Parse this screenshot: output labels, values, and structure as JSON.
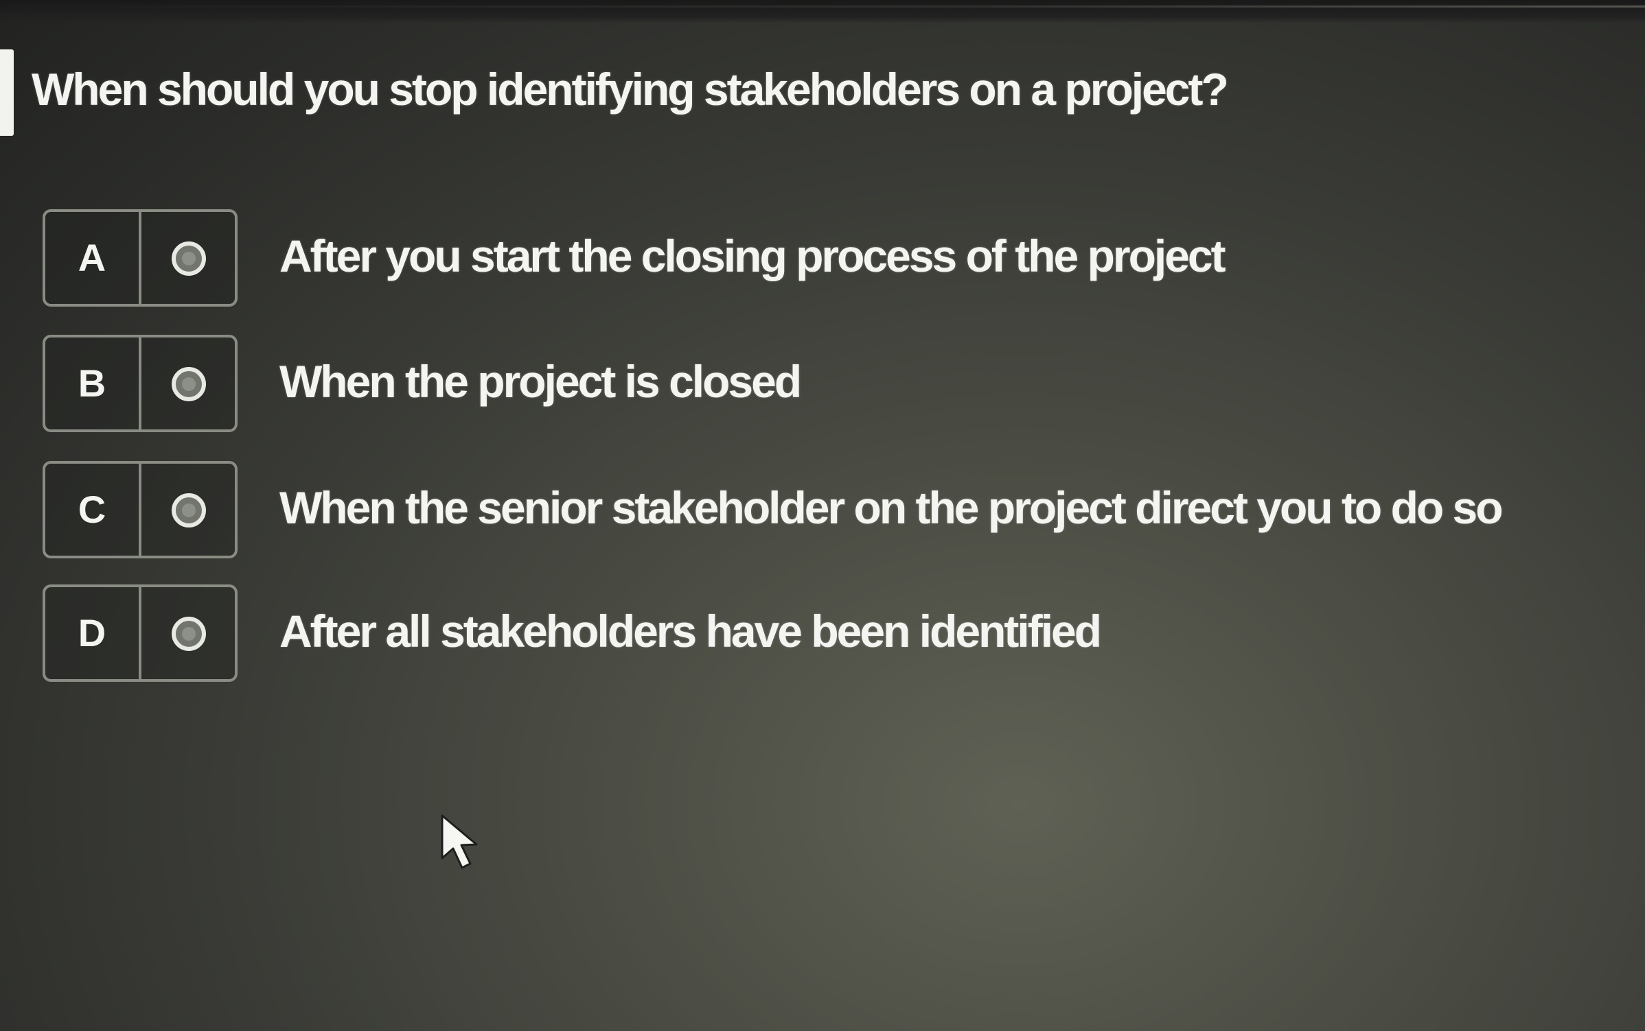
{
  "question": {
    "text": "When should you stop identifying stakeholders on a project?"
  },
  "options": [
    {
      "letter": "A",
      "text": "After you start the closing process of the project",
      "selected": false
    },
    {
      "letter": "B",
      "text": "When the project is closed",
      "selected": false
    },
    {
      "letter": "C",
      "text": "When the senior stakeholder on the project direct you to do so",
      "selected": false
    },
    {
      "letter": "D",
      "text": "After all stakeholders have been identified",
      "selected": false
    }
  ],
  "icons": {
    "radio": "radio-button-icon",
    "cursor": "mouse-pointer-icon"
  },
  "colors": {
    "background": "#3a3b36",
    "text": "#f4f4f0",
    "border": "#8a8c84",
    "accent_bar": "#f2f2ee"
  }
}
